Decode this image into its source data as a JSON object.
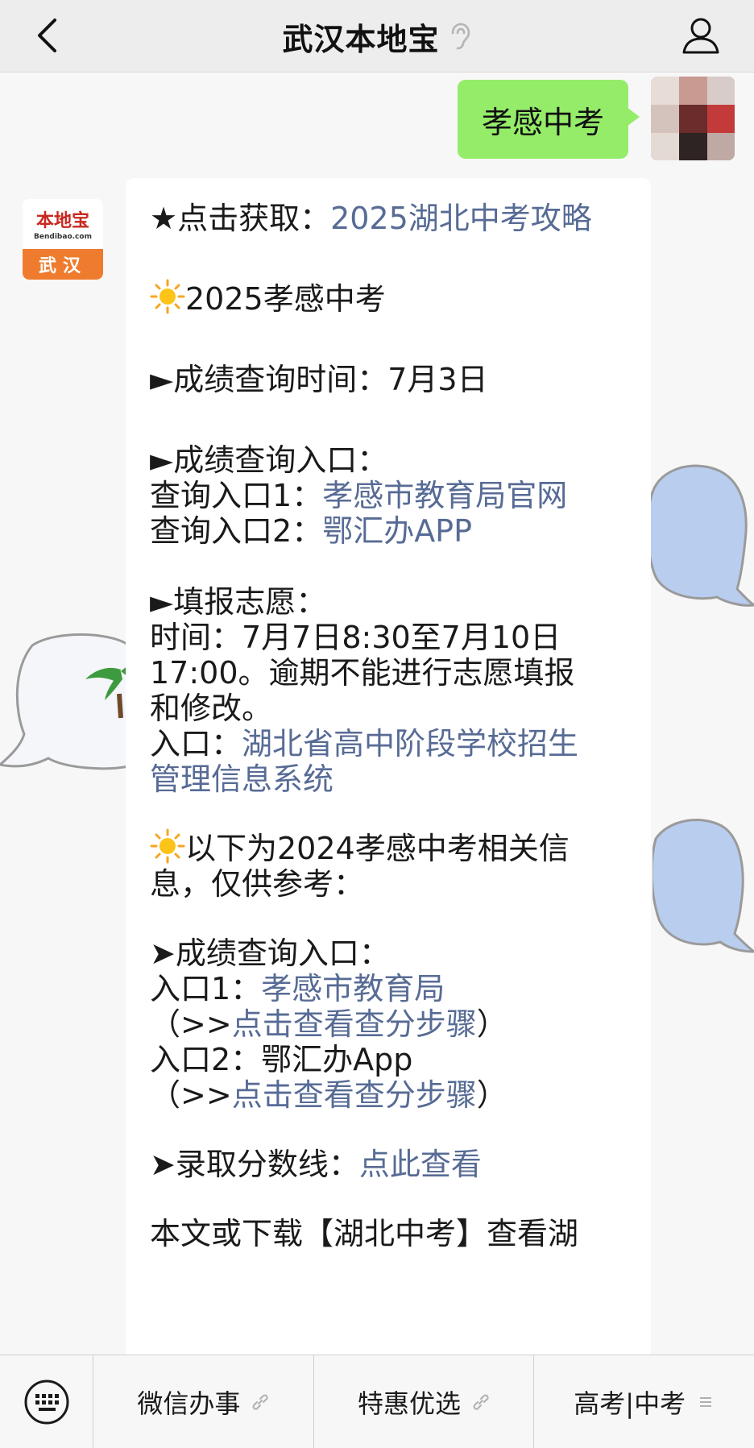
{
  "header": {
    "title": "武汉本地宝",
    "icons": [
      "back-icon",
      "ear-mute-icon",
      "profile-icon"
    ]
  },
  "outgoing": {
    "text": "孝感中考"
  },
  "account_avatar": {
    "logo": "本地宝",
    "logo_sub": "Bendibao.com",
    "city": "武汉"
  },
  "message": {
    "line1_prefix": "★点击获取：",
    "line1_link": "2025湖北中考攻略",
    "section1_title": "2025孝感中考",
    "query_time": "►成绩查询时间：7月3日",
    "query_entry_title": "►成绩查询入口：",
    "entry1_prefix": "查询入口1：",
    "entry1_link": "孝感市教育局官网",
    "entry2_prefix": "查询入口2：",
    "entry2_link": "鄂汇办APP",
    "volunteer_title": "►填报志愿：",
    "volunteer_time_1": "时间：7月7日8:30至7月10日",
    "volunteer_time_2": "17:00。逾期不能进行志愿填报",
    "volunteer_time_3": "和修改。",
    "volunteer_entry_prefix": "入口：",
    "volunteer_entry_link_1": "湖北省高中阶段学校招生",
    "volunteer_entry_link_2": "管理信息系统",
    "section2_title_1": "以下为2024孝感中考相关信",
    "section2_title_2": "息，仅供参考：",
    "query2_title": "➤成绩查询入口：",
    "q2_entry1_prefix": "入口1：",
    "q2_entry1_link": "孝感市教育局",
    "steps_open": "（>>",
    "steps_link": "点击查看查分步骤",
    "steps_close": "）",
    "q2_entry2": "入口2：鄂汇办App",
    "score_line_prefix": "➤录取分数线：",
    "score_line_link": "点此查看",
    "partial_line": "本文或下载【湖北中考】查看湖"
  },
  "menu": {
    "items": [
      {
        "label": "微信办事",
        "icon": "link-icon"
      },
      {
        "label": "特惠优选",
        "icon": "link-icon"
      },
      {
        "label": "高考|中考",
        "icon": "menu-lines-icon"
      }
    ]
  },
  "colors": {
    "header_bg": "#ededed",
    "chat_bg": "#f7f7f7",
    "outgoing_bubble": "#95ec69",
    "link": "#576b95",
    "logo_orange": "#ef7c2e",
    "logo_red": "#c8281f"
  }
}
